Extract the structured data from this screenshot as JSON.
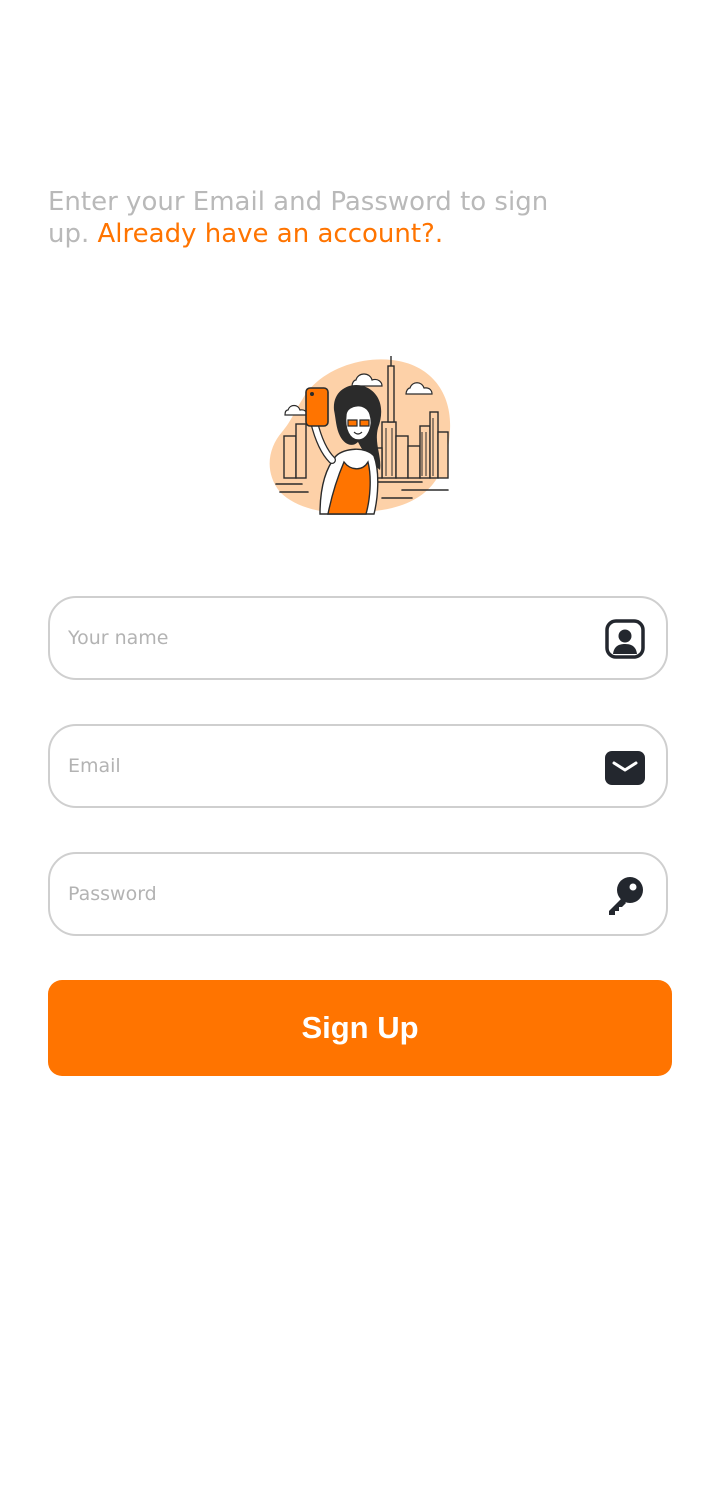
{
  "intro": {
    "text": "Enter your Email and Password to sign up. ",
    "link": "Already have an account?."
  },
  "illustration": {
    "name": "woman-selfie-city-illustration"
  },
  "form": {
    "name": {
      "placeholder": "Your name",
      "value": "",
      "icon": "user-profile-icon"
    },
    "email": {
      "placeholder": "Email",
      "value": "",
      "icon": "mail-icon"
    },
    "password": {
      "placeholder": "Password",
      "value": "",
      "icon": "key-icon"
    }
  },
  "signup_button": {
    "label": "Sign Up"
  },
  "colors": {
    "accent": "#ff7400",
    "muted_text": "#b9b9b9",
    "border": "#cfcfcf",
    "icon": "#23272e"
  }
}
